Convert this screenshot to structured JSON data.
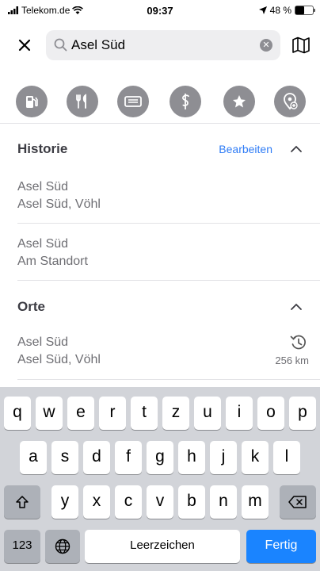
{
  "status": {
    "carrier": "Telekom.de",
    "time": "09:37",
    "battery": "48 %",
    "battery_fraction": 0.48
  },
  "search": {
    "query": "Asel Süd",
    "placeholder": ""
  },
  "categories": [
    "fuel-icon",
    "restaurant-icon",
    "hotel-icon",
    "health-icon",
    "favorites-icon",
    "add-location-icon"
  ],
  "history": {
    "title": "Historie",
    "edit_label": "Bearbeiten",
    "items": [
      {
        "line1": "Asel Süd",
        "line2": "Asel Süd, Vöhl"
      },
      {
        "line1": "Asel Süd",
        "line2": "Am Standort"
      }
    ]
  },
  "places": {
    "title": "Orte",
    "items": [
      {
        "line1": "Asel Süd",
        "line2": "Asel Süd, Vöhl",
        "distance": "256 km"
      }
    ]
  },
  "keyboard": {
    "row1": [
      "q",
      "w",
      "e",
      "r",
      "t",
      "z",
      "u",
      "i",
      "o",
      "p"
    ],
    "row2": [
      "a",
      "s",
      "d",
      "f",
      "g",
      "h",
      "j",
      "k",
      "l"
    ],
    "row3": [
      "y",
      "x",
      "c",
      "v",
      "b",
      "n",
      "m"
    ],
    "numbers_label": "123",
    "space_label": "Leerzeichen",
    "return_label": "Fertig"
  }
}
